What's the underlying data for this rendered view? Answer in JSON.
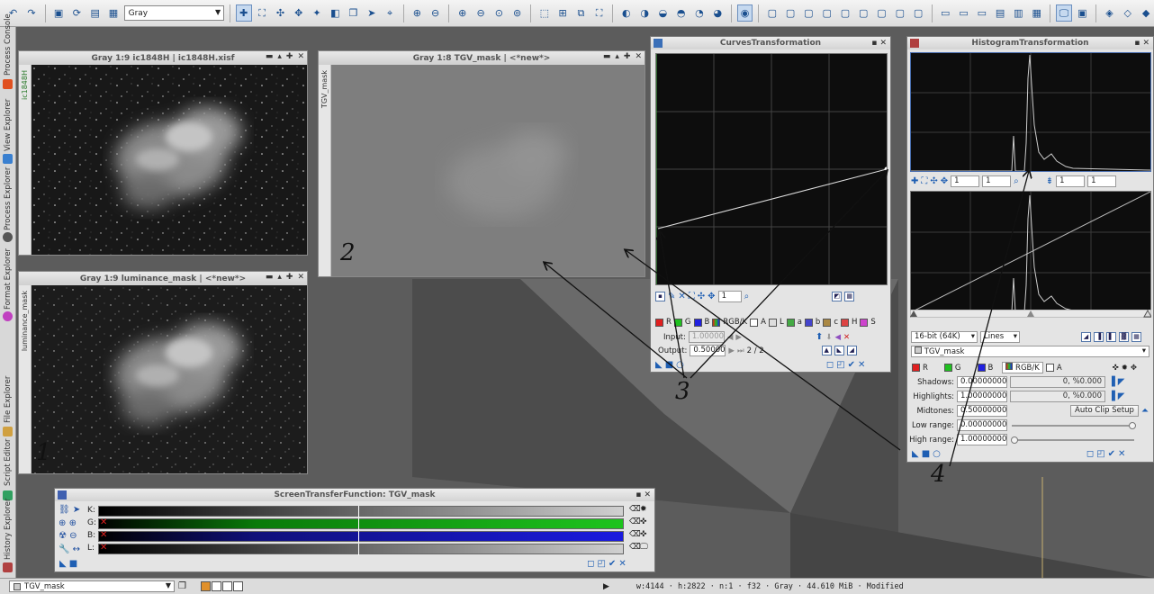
{
  "toolbar": {
    "image_mode_combo": "Gray"
  },
  "left_tabs": [
    "Process Console",
    "View Explorer",
    "Process Explorer",
    "Format Explorer",
    "File Explorer",
    "Script Editor",
    "History Explorer"
  ],
  "windows": {
    "ic1848h": {
      "title": "Gray 1:9 ic1848H | ic1848H.xisf",
      "side_label": "ic1848H"
    },
    "luminance": {
      "title": "Gray 1:9 luminance_mask | <*new*>",
      "side_label": "luminance_mask"
    },
    "tgv": {
      "title": "Gray 1:8 TGV_mask | <*new*>",
      "side_label": "TGV_mask"
    }
  },
  "curves": {
    "title": "CurvesTransformation",
    "zoom_value": "1",
    "channels": [
      "R",
      "G",
      "B",
      "RGB/K",
      "A",
      "L",
      "a",
      "b",
      "c",
      "H",
      "S"
    ],
    "input_label": "Input:",
    "input_value": "1.00000",
    "output_label": "Output:",
    "output_value": "0.50000",
    "point_counter": "2 / 2"
  },
  "histogram": {
    "title": "HistogramTransformation",
    "zoom_fields": [
      "1",
      "1",
      "1",
      "1"
    ],
    "resolution": "16-bit (64K)",
    "graph_style": "Lines",
    "target_view": "TGV_mask",
    "channels": [
      "R",
      "G",
      "B",
      "RGB/K",
      "A"
    ],
    "shadows_label": "Shadows:",
    "shadows_value": "0.00000000",
    "shadows_clip": "0, %0.000",
    "highlights_label": "Highlights:",
    "highlights_value": "1.00000000",
    "highlights_clip": "0, %0.000",
    "midtones_label": "Midtones:",
    "midtones_value": "0.50000000",
    "auto_clip_label": "Auto Clip Setup",
    "low_range_label": "Low range:",
    "low_range_value": "0.00000000",
    "high_range_label": "High range:",
    "high_range_value": "1.00000000"
  },
  "stf": {
    "title": "ScreenTransferFunction: TGV_mask",
    "channels": [
      {
        "label": "K:",
        "color": "#d0d0d0"
      },
      {
        "label": "G:",
        "color": "#1ec41e"
      },
      {
        "label": "B:",
        "color": "#1a1adf"
      },
      {
        "label": "L:",
        "color": "#d0d0d0"
      }
    ]
  },
  "statusbar": {
    "view": "TGV_mask",
    "info": "w:4144 · h:2822 · n:1 · f32 · Gray · 44.610 MiB · Modified"
  },
  "annotations": [
    "1",
    "2",
    "3",
    "4"
  ]
}
